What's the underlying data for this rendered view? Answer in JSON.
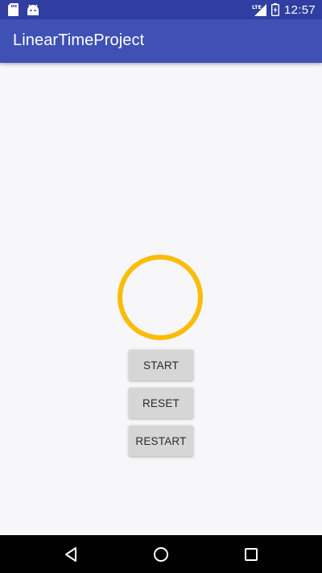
{
  "status_bar": {
    "time": "12:57",
    "network_label": "LTE",
    "icons": [
      "sd-card-icon",
      "android-debug-icon",
      "lte-signal-icon",
      "battery-charging-icon"
    ]
  },
  "app_bar": {
    "title": "LinearTimeProject"
  },
  "timer": {
    "ring_color": "#fbbc05",
    "progress": 1.0
  },
  "buttons": {
    "start_label": "START",
    "reset_label": "RESET",
    "restart_label": "RESTART"
  },
  "nav_bar": {
    "icons": [
      "back-icon",
      "home-icon",
      "recents-icon"
    ]
  },
  "colors": {
    "primary": "#3f51b5",
    "primary_dark": "#2f3ea0",
    "background": "#f7f6f8",
    "button": "#d6d6d6"
  }
}
